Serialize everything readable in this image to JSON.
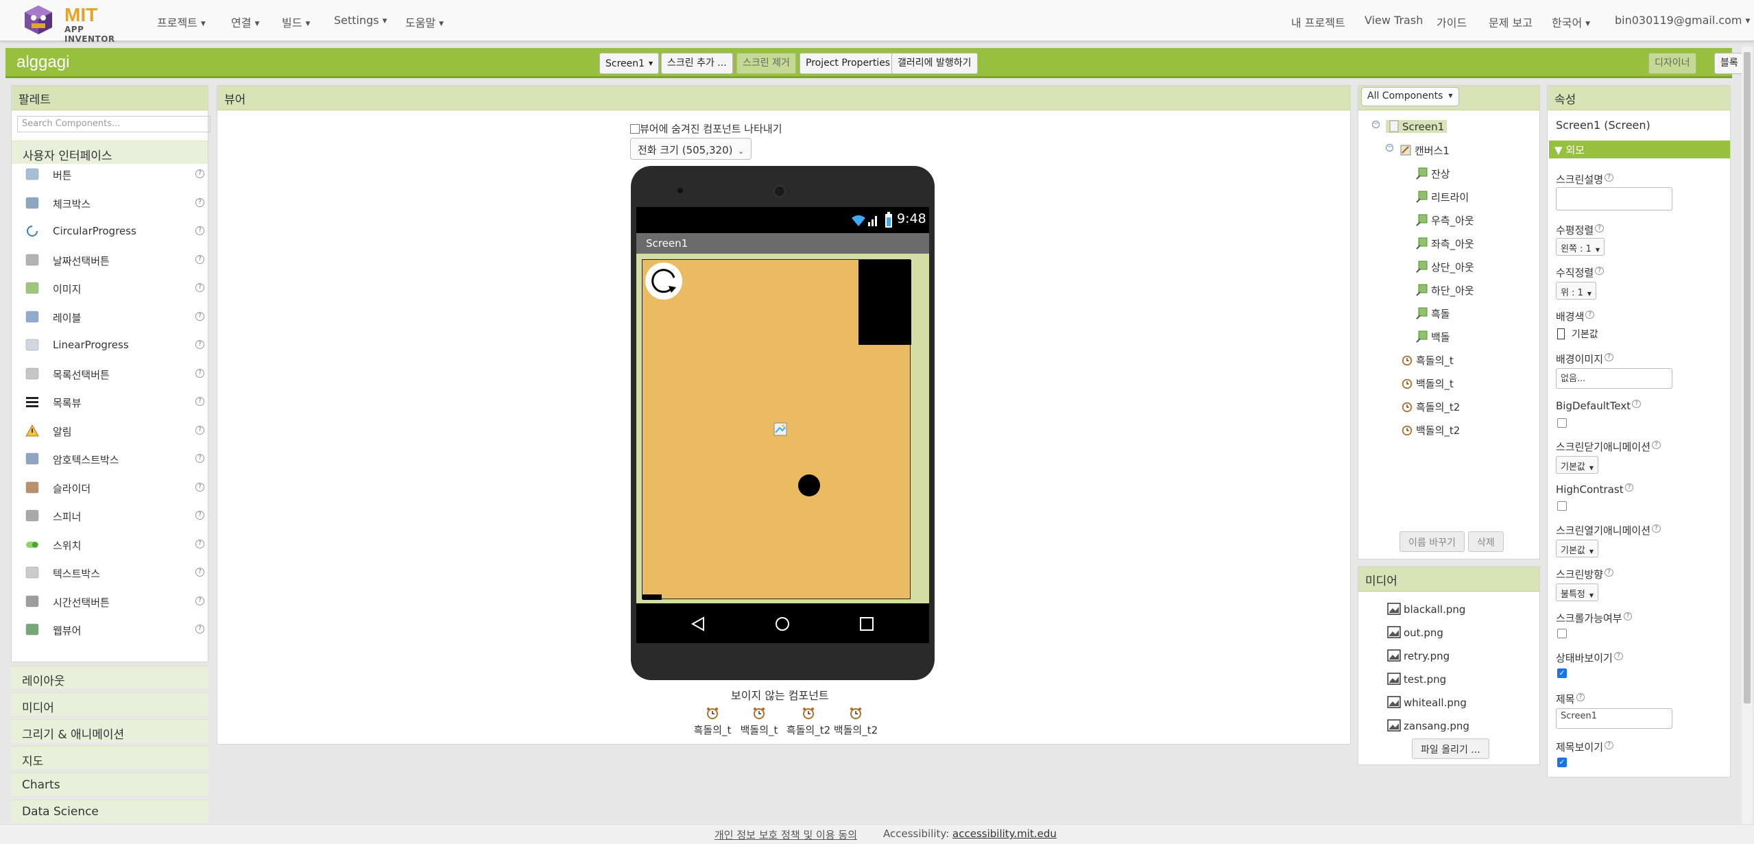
{
  "topbar": {
    "logo_main": "MIT",
    "logo_sub": "APP INVENTOR",
    "menus": [
      "프로젝트",
      "연결",
      "빌드",
      "Settings",
      "도움말"
    ],
    "right_links": [
      "내 프로젝트",
      "View Trash",
      "가이드",
      "문제 보고",
      "한국어",
      "bin030119@gmail.com"
    ]
  },
  "project": {
    "name": "alggagi",
    "screen_select": "Screen1",
    "add_screen": "스크린 추가 ...",
    "remove_screen": "스크린 제거",
    "project_props": "Project Properties",
    "publish": "갤러리에 발행하기",
    "designer": "디자이너",
    "blocks": "블록"
  },
  "palette": {
    "title": "팔레트",
    "search_placeholder": "Search Components...",
    "ui_category": "사용자 인터페이스",
    "items": [
      "버튼",
      "체크박스",
      "CircularProgress",
      "날짜선택버튼",
      "이미지",
      "레이블",
      "LinearProgress",
      "목록선택버튼",
      "목록뷰",
      "알림",
      "암호텍스트박스",
      "슬라이더",
      "스피너",
      "스위치",
      "텍스트박스",
      "시간선택버튼",
      "웹뷰어"
    ],
    "categories": [
      "레이아웃",
      "미디어",
      "그리기 & 애니메이션",
      "지도",
      "Charts",
      "Data Science"
    ]
  },
  "viewer": {
    "title": "뷰어",
    "show_hidden": "뷰어에 숨겨진 컴포넌트 나타내기",
    "size_select": "전화 크기 (505,320)",
    "status_time": "9:48",
    "screen_title": "Screen1",
    "nonvisible_title": "보이지 않는 컴포넌트",
    "nonvisible": [
      "흑돌의_t",
      "백돌의_t",
      "흑돌의_t2",
      "백돌의_t2"
    ]
  },
  "components": {
    "filter": "All Components",
    "tree": {
      "screen": "Screen1",
      "canvas": "캔버스1",
      "sprites": [
        "잔상",
        "리트라이",
        "우측_아웃",
        "좌측_아웃",
        "상단_아웃",
        "하단_아웃",
        "흑돌",
        "백돌"
      ],
      "clocks": [
        "흑돌의_t",
        "백돌의_t",
        "흑돌의_t2",
        "백돌의_t2"
      ]
    },
    "rename": "이름 바꾸기",
    "delete": "삭제"
  },
  "media": {
    "title": "미디어",
    "files": [
      "blackall.png",
      "out.png",
      "retry.png",
      "test.png",
      "whiteall.png",
      "zansang.png"
    ],
    "upload": "파일 올리기 ..."
  },
  "properties": {
    "title": "속성",
    "subject": "Screen1 (Screen)",
    "section": "외모",
    "labels": {
      "about": "스크린설명",
      "align_h": "수평정렬",
      "align_v": "수직정렬",
      "bgcolor": "배경색",
      "bgimage": "배경이미지",
      "bigtext": "BigDefaultText",
      "close_anim": "스크린닫기애니메이션",
      "highcontrast": "HighContrast",
      "open_anim": "스크린열기애니메이션",
      "orientation": "스크린방향",
      "scrollable": "스크롤가능여부",
      "show_status": "상태바보이기",
      "title": "제목",
      "show_title": "제목보이기"
    },
    "values": {
      "align_h": "왼쪽 : 1",
      "align_v": "위 : 1",
      "bgcolor": "기본값",
      "bgimage": "없음...",
      "close_anim": "기본값",
      "open_anim": "기본값",
      "orientation": "불특정",
      "title": "Screen1"
    }
  },
  "footer": {
    "privacy": "개인 정보 보호 정책 및 이용 동의",
    "accessibility_label": "Accessibility:",
    "accessibility_link": "accessibility.mit.edu"
  }
}
